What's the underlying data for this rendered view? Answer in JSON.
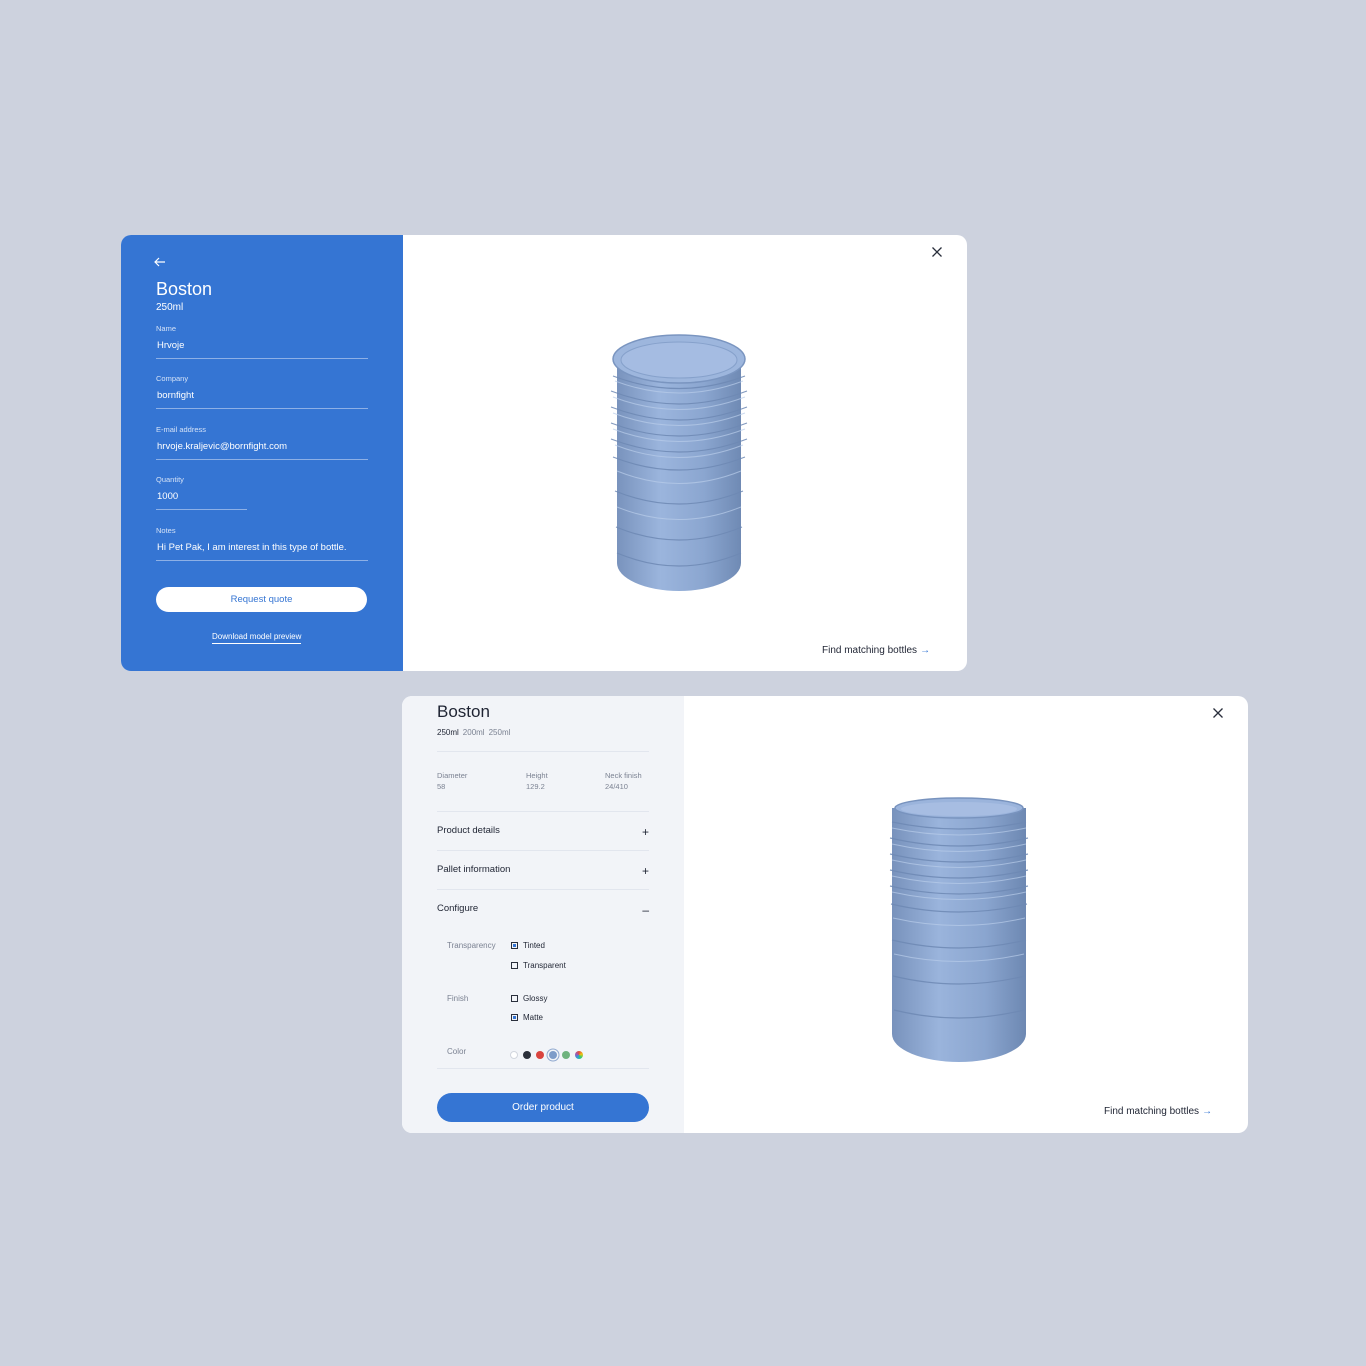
{
  "quote_card": {
    "product_name": "Boston",
    "product_size": "250ml",
    "fields": [
      {
        "label": "Name",
        "value": "Hrvoje"
      },
      {
        "label": "Company",
        "value": "bornfight"
      },
      {
        "label": "E-mail address",
        "value": "hrvoje.kraljevic@bornfight.com"
      },
      {
        "label": "Quantity",
        "value": "1000"
      },
      {
        "label": "Notes",
        "value": "Hi Pet Pak, I am interest in this type of bottle."
      }
    ],
    "request_button": "Request quote",
    "download_link": "Download model preview",
    "find_link": "Find matching bottles",
    "find_arrow": "→",
    "icons": [
      "back-arrow-icon",
      "close-icon",
      "arrow-right-icon"
    ]
  },
  "config_card": {
    "product_name": "Boston",
    "sizes": [
      "250ml",
      "200ml",
      "250ml"
    ],
    "active_size_index": 0,
    "specs": [
      {
        "label": "Diameter",
        "value": "58"
      },
      {
        "label": "Height",
        "value": "129.2"
      },
      {
        "label": "Neck finish",
        "value": "24/410"
      }
    ],
    "sections": [
      {
        "label": "Product details",
        "sign": "+"
      },
      {
        "label": "Pallet information",
        "sign": "+"
      },
      {
        "label": "Configure",
        "sign": "–"
      }
    ],
    "transparency": {
      "label": "Transparency",
      "options": [
        {
          "label": "Tinted",
          "checked": true
        },
        {
          "label": "Transparent",
          "checked": false
        }
      ]
    },
    "finish": {
      "label": "Finish",
      "options": [
        {
          "label": "Glossy",
          "checked": false
        },
        {
          "label": "Matte",
          "checked": true
        }
      ]
    },
    "color": {
      "label": "Color",
      "swatches": [
        "#ffffff",
        "#2b2f3a",
        "#d9443f",
        "#7e9cc9",
        "#6fb37e",
        "multicolor"
      ],
      "selected_index": 3
    },
    "order_button": "Order product",
    "find_link": "Find matching bottles",
    "find_arrow": "→"
  },
  "colors": {
    "background": "#cdd2de",
    "accent_blue": "#3575d3",
    "panel_grey": "#f2f4f8",
    "bottle_blue": "#8aa7d1"
  }
}
